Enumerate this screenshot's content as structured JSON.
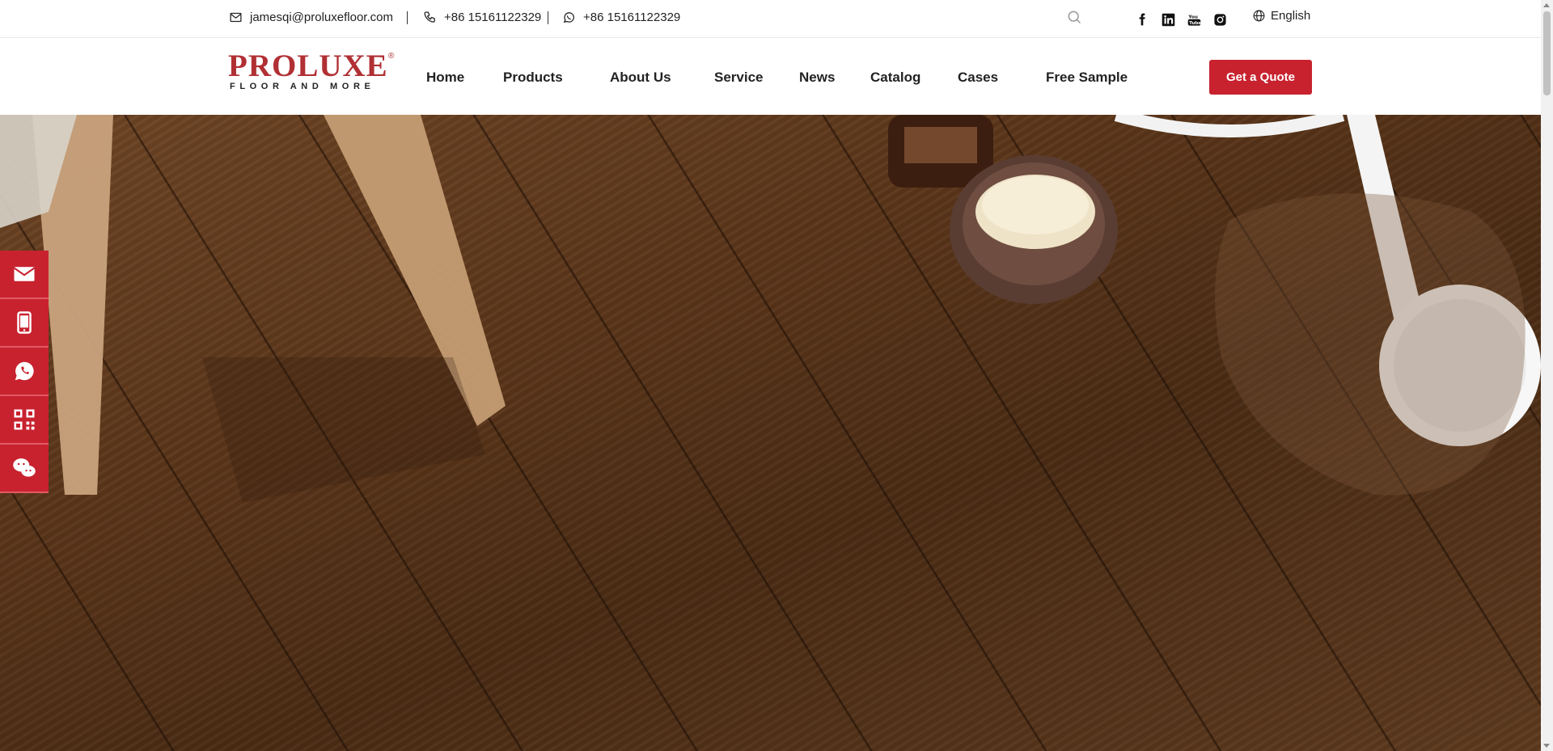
{
  "topbar": {
    "email": "jamesqi@proluxefloor.com",
    "phone": "+86 15161122329",
    "whatsapp": "+86 15161122329",
    "language": "English",
    "social_icons": [
      "facebook-icon",
      "linkedin-icon",
      "youtube-icon",
      "instagram-icon"
    ]
  },
  "logo": {
    "brand": "PROLUXE",
    "registered": "®",
    "tagline": "FLOOR AND MORE"
  },
  "nav": {
    "items": [
      "Home",
      "Products",
      "About Us",
      "Service",
      "News",
      "Catalog",
      "Cases",
      "Free Sample"
    ],
    "cta": "Get a Quote"
  },
  "sidebar": {
    "icons": [
      "email-icon",
      "mobile-icon",
      "whatsapp-icon",
      "qr-code-icon",
      "wechat-icon"
    ]
  },
  "colors": {
    "accent": "#c8222f",
    "brand": "#b03034"
  }
}
